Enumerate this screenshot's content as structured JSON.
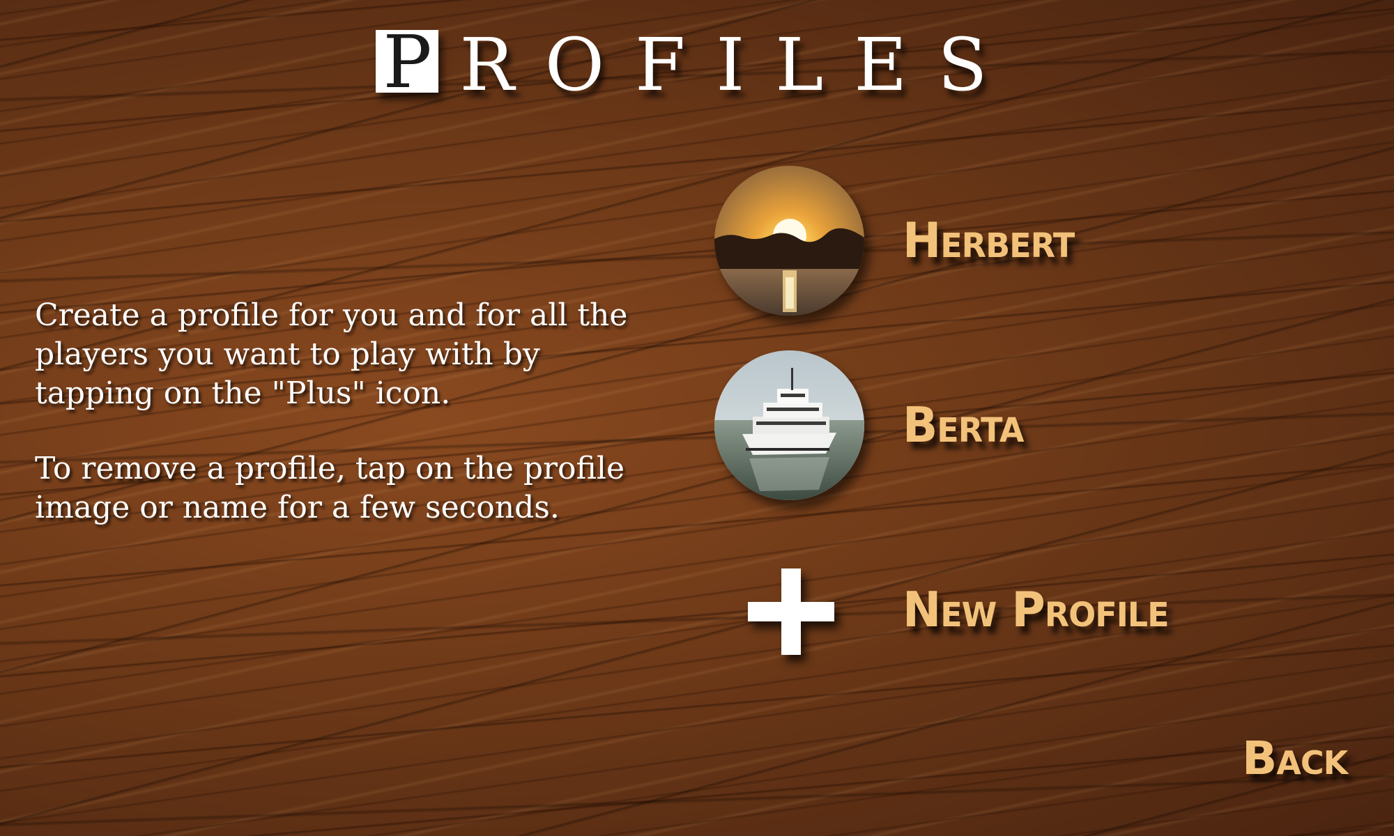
{
  "title": {
    "first_letter": "P",
    "rest": "ROFILES"
  },
  "instructions": {
    "paragraph_1": "Create a profile for you and for all the players you want to play with by tapping on the \"Plus\" icon.",
    "paragraph_2": "To remove a profile, tap on the profile image or name for a few seconds."
  },
  "profiles": [
    {
      "name": "Herbert",
      "avatar_icon": "sunset-photo"
    },
    {
      "name": "Berta",
      "avatar_icon": "ship-photo"
    }
  ],
  "new_profile": {
    "label": "New Profile",
    "icon": "plus-icon"
  },
  "back_button": {
    "label": "Back"
  },
  "colors": {
    "wood": "#6d3918",
    "label_gold": "#f3c27a",
    "text_white": "#ffffff"
  }
}
